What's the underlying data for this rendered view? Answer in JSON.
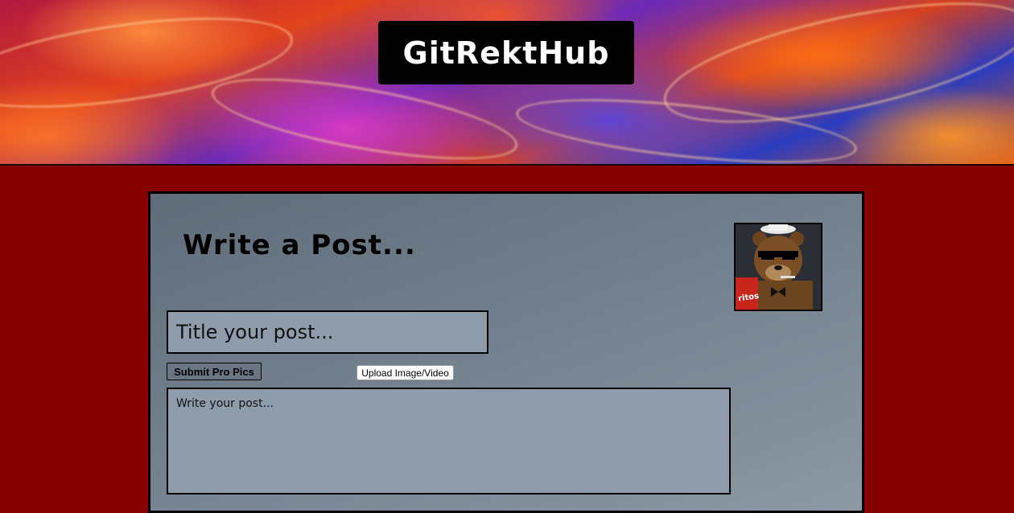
{
  "header": {
    "logo_text": "GitRektHub"
  },
  "composer": {
    "heading": "Write a Post...",
    "title_placeholder": "Title your post...",
    "submit_label": "Submit Pro Pics",
    "upload_label": "Upload Image/Video",
    "body_placeholder": "Write your post...",
    "avatar_icon": "user-avatar-icon"
  },
  "colors": {
    "page_background": "#870000",
    "panel_background": "#6f7c8a",
    "input_background": "#8f9cab",
    "logo_background": "#000000",
    "logo_text": "#ffffff"
  }
}
